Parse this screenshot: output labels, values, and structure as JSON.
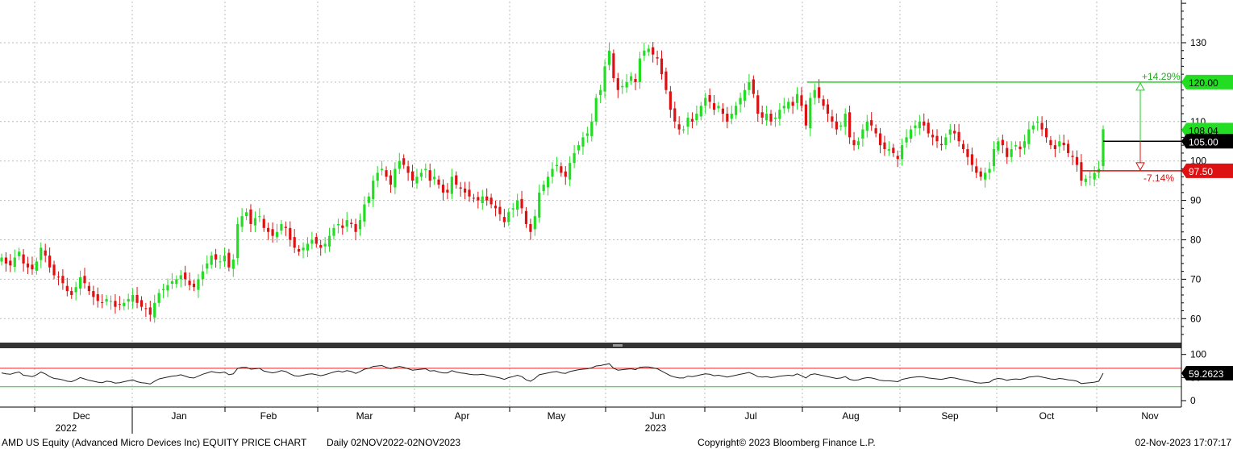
{
  "chart_data": {
    "type": "candlestick",
    "ticker": "AMD US Equity (Advanced Micro Devices Inc) EQUITY PRICE CHART",
    "period": "Daily 02NOV2022-02NOV2023",
    "copyright": "Copyright© 2023 Bloomberg Finance L.P.",
    "timestamp": "02-Nov-2023 17:07:17",
    "price_axis": {
      "ticks": [
        "130",
        "120",
        "110",
        "100",
        "90",
        "80",
        "70",
        "60"
      ],
      "ylim": [
        55,
        140
      ]
    },
    "rsi_axis": {
      "ticks": [
        "100",
        "50",
        "0"
      ],
      "ylim": [
        -5,
        110
      ],
      "upper_band": 70,
      "lower_band": 30
    },
    "x_labels": [
      "Dec",
      "Jan",
      "Feb",
      "Mar",
      "Apr",
      "May",
      "Jun",
      "Jul",
      "Aug",
      "Sep",
      "Oct",
      "Nov"
    ],
    "year_labels": [
      "2022",
      "2023"
    ],
    "colors": {
      "up": "#22dd22",
      "down": "#dd1111",
      "grid": "#bbbbbb",
      "target": "#22cc22",
      "stop": "#dd1111",
      "entry": "#000000"
    },
    "closes": [
      75.5,
      74.0,
      73.5,
      75.5,
      77.0,
      74.0,
      73.0,
      72.5,
      74.5,
      78.0,
      76.0,
      73.0,
      71.0,
      70.5,
      69.0,
      67.0,
      66.0,
      68.0,
      70.5,
      69.0,
      67.0,
      65.5,
      64.5,
      64.0,
      65.0,
      64.5,
      63.0,
      63.5,
      64.0,
      65.0,
      66.0,
      64.0,
      63.0,
      62.5,
      61.0,
      64.0,
      66.5,
      67.5,
      68.5,
      69.5,
      70.0,
      71.0,
      70.0,
      68.5,
      68.0,
      70.0,
      72.0,
      74.0,
      76.0,
      75.0,
      74.5,
      76.0,
      73.0,
      75.0,
      84.0,
      86.0,
      87.0,
      84.0,
      85.5,
      86.0,
      83.0,
      82.0,
      81.0,
      82.0,
      84.0,
      83.0,
      80.0,
      78.0,
      77.0,
      78.0,
      79.0,
      80.0,
      79.0,
      78.0,
      79.0,
      81.0,
      83.0,
      84.0,
      83.0,
      85.0,
      84.0,
      82.0,
      85.0,
      89.0,
      91.0,
      95.0,
      97.0,
      98.0,
      96.0,
      94.0,
      98.0,
      100.0,
      99.0,
      97.0,
      95.0,
      96.0,
      97.0,
      98.0,
      95.0,
      96.0,
      94.0,
      92.0,
      92.0,
      96.0,
      94.0,
      93.0,
      92.0,
      91.0,
      90.5,
      90.0,
      91.0,
      90.0,
      89.0,
      88.0,
      86.5,
      84.5,
      87.0,
      88.0,
      90.0,
      88.0,
      84.0,
      82.0,
      86.0,
      92.0,
      94.0,
      96.0,
      98.0,
      99.0,
      97.0,
      96.0,
      99.5,
      102.0,
      104.0,
      106.0,
      107.0,
      110.0,
      116.0,
      118.0,
      124.0,
      128.0,
      121.0,
      118.0,
      119.0,
      120.0,
      121.5,
      120.0,
      126.0,
      128.0,
      128.5,
      127.0,
      126.0,
      122.0,
      118.0,
      113.0,
      110.0,
      108.0,
      108.0,
      111.0,
      110.0,
      112.0,
      114.0,
      116.0,
      115.0,
      113.0,
      114.0,
      112.0,
      110.0,
      112.0,
      114.0,
      116.0,
      118.0,
      120.0,
      117.0,
      112.0,
      111.0,
      112.0,
      110.0,
      111.0,
      113.0,
      114.0,
      115.0,
      114.0,
      117.0,
      114.0,
      109.0,
      116.0,
      118.0,
      116.0,
      114.0,
      112.0,
      110.0,
      108.0,
      109.0,
      112.0,
      106.0,
      104.0,
      105.0,
      108.0,
      110.0,
      109.0,
      107.0,
      104.0,
      103.0,
      103.0,
      102.0,
      100.5,
      104.0,
      106.0,
      108.0,
      109.0,
      110.0,
      109.0,
      107.0,
      106.0,
      105.0,
      104.0,
      106.0,
      108.0,
      107.0,
      105.0,
      103.0,
      101.0,
      99.0,
      97.0,
      96.0,
      97.0,
      98.0,
      103.0,
      105.0,
      104.0,
      101.0,
      103.0,
      104.0,
      103.0,
      105.0,
      108.0,
      109.0,
      110.0,
      108.0,
      106.0,
      104.0,
      103.0,
      105.0,
      104.0,
      102.0,
      101.0,
      99.0,
      95.0,
      95.5,
      96.0,
      97.0,
      98.0,
      108.04
    ],
    "rsi": [
      60,
      58,
      57,
      60,
      62,
      55,
      54,
      52,
      56,
      62,
      58,
      52,
      48,
      47,
      45,
      42,
      41,
      45,
      50,
      47,
      44,
      42,
      40,
      39,
      42,
      41,
      38,
      39,
      41,
      43,
      45,
      41,
      39,
      38,
      36,
      42,
      47,
      49,
      51,
      53,
      54,
      56,
      53,
      50,
      49,
      53,
      57,
      60,
      63,
      61,
      60,
      62,
      56,
      58,
      70,
      72,
      72,
      68,
      69,
      70,
      64,
      62,
      60,
      62,
      65,
      63,
      58,
      54,
      53,
      55,
      57,
      58,
      56,
      54,
      56,
      59,
      62,
      64,
      62,
      65,
      63,
      59,
      63,
      68,
      70,
      74,
      75,
      76,
      72,
      69,
      72,
      74,
      72,
      69,
      66,
      67,
      68,
      69,
      64,
      65,
      62,
      60,
      60,
      65,
      62,
      60,
      59,
      57,
      56,
      56,
      57,
      55,
      53,
      51,
      49,
      46,
      50,
      52,
      55,
      52,
      45,
      42,
      48,
      56,
      58,
      60,
      62,
      63,
      60,
      59,
      63,
      65,
      67,
      68,
      69,
      71,
      75,
      76,
      78,
      80,
      70,
      66,
      67,
      68,
      69,
      67,
      72,
      73,
      73,
      71,
      69,
      64,
      59,
      54,
      51,
      49,
      49,
      53,
      52,
      54,
      56,
      58,
      57,
      54,
      55,
      53,
      51,
      53,
      55,
      57,
      59,
      61,
      57,
      52,
      51,
      52,
      50,
      51,
      53,
      54,
      55,
      54,
      58,
      54,
      49,
      56,
      58,
      56,
      54,
      52,
      50,
      48,
      49,
      52,
      46,
      44,
      45,
      48,
      50,
      49,
      47,
      44,
      43,
      43,
      42,
      41,
      46,
      48,
      50,
      51,
      52,
      51,
      49,
      48,
      47,
      46,
      48,
      50,
      49,
      47,
      45,
      43,
      41,
      39,
      38,
      39,
      40,
      46,
      48,
      47,
      44,
      46,
      47,
      46,
      48,
      51,
      52,
      53,
      51,
      49,
      47,
      46,
      48,
      47,
      45,
      44,
      42,
      37,
      38,
      39,
      40,
      42,
      59.26
    ],
    "entry": {
      "price": 105.0,
      "label": "105.00"
    },
    "target": {
      "price": 120.0,
      "label": "120.00",
      "pct": "+14.29%"
    },
    "stop": {
      "price": 97.5,
      "label": "97.50",
      "pct": "-7.14%"
    },
    "last_price": {
      "price": 108.04,
      "label": "108.04"
    },
    "last_rsi": {
      "value": 59.26,
      "label": "59.2623"
    }
  }
}
